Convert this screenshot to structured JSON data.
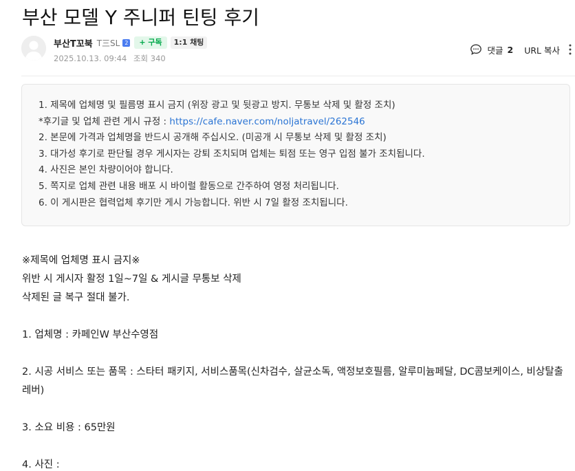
{
  "post": {
    "title": "부산 모델 Y 주니퍼 틴팅 후기"
  },
  "author": {
    "name": "부산T꼬북",
    "group": "T三SL",
    "level_badge": "2",
    "subscribe_label": "+ 구독",
    "chat_label": "1:1 채팅"
  },
  "meta": {
    "date": "2025.10.13. 09:44",
    "views": "조회 340"
  },
  "actions": {
    "comment_label": "댓글",
    "comment_count": "2",
    "url_copy_label": "URL 복사"
  },
  "notice": {
    "line1": "1. 제목에 업체명 및 필름명 표시 금지 (위장 광고 및 뒷광고 방지. 무통보 삭제 및 활정 조치)",
    "line2_prefix": "*후기글 및 업체 관련 게시 규정 : ",
    "line2_link": "https://cafe.naver.com/noljatravel/262546",
    "line3": "2. 본문에 가격과 업체명을 반드시 공개해 주십시오. (미공개 시 무통보 삭제 및 활정 조치)",
    "line4": "3. 대가성 후기로 판단될 경우 게시자는 강퇴 조치되며 업체는 퇴점 또는 영구 입점 불가 조치됩니다.",
    "line5": "4. 사진은 본인 차량이어야 합니다.",
    "line6": "5. 쪽지로 업체 관련 내용 배포 시 바이럴 활동으로 간주하여 영정 처리됩니다.",
    "line7": "6. 이 게시판은 협력업체 후기만 게시 가능합니다. 위반 시 7일 활정 조치됩니다."
  },
  "body": {
    "warning_title": "※제목에 업체명 표시 금지※",
    "warning_penalty": "위반 시 게시자 활정 1일~7일 & 게시글 무통보 삭제",
    "warning_no_restore": "삭제된 글 복구 절대 불가.",
    "company": "1. 업체명 :  카페인W 부산수영점",
    "service": "2. 시공 서비스 또는 품목 :  스타터 패키지, 서비스품목(신차검수, 살균소독, 액정보호필름, 알루미늄페달, DC콤보케이스, 비상탈출레버)",
    "cost": "3. 소요 비용 :  65만원",
    "photo": "4. 사진 :"
  },
  "colors": {
    "subscribe_bg": "#e3f7ea",
    "subscribe_text": "#03a94c",
    "link": "#2a74d4",
    "level_badge": "#4a7cf0"
  },
  "icons": [
    "avatar-default-icon",
    "level-badge-icon",
    "comment-icon",
    "more-vertical-icon"
  ]
}
